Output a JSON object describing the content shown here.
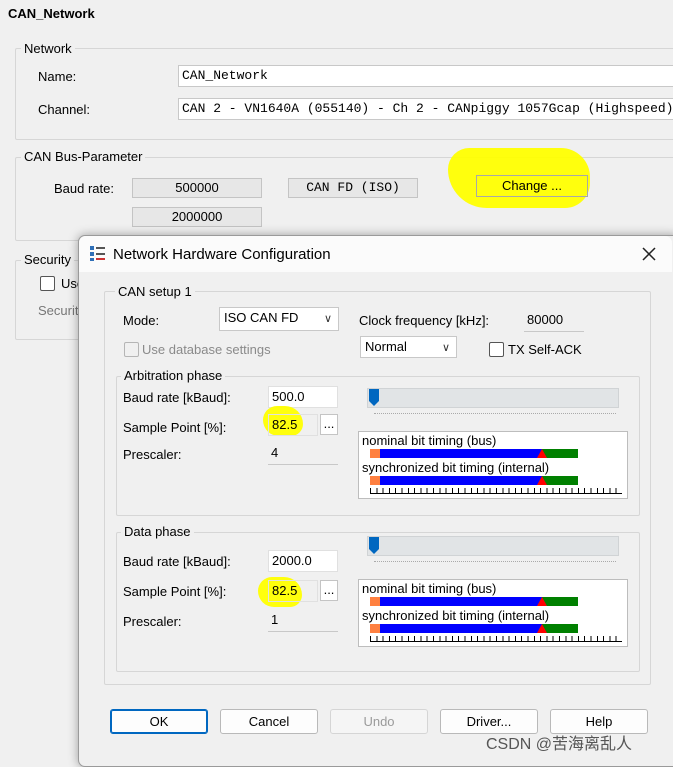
{
  "main": {
    "title": "CAN_Network",
    "network_group": "Network",
    "name_label": "Name:",
    "name_value": "CAN_Network",
    "channel_label": "Channel:",
    "channel_value": "CAN 2 - VN1640A (055140) - Ch 2 - CANpiggy 1057Gcap (Highspeed)",
    "bus_group": "CAN Bus-Parameter",
    "baud_label": "Baud rate:",
    "baud_value": "500000",
    "data_baud_value": "2000000",
    "canfd_button": "CAN FD (ISO)",
    "change_button": "Change ...",
    "security_group": "Security",
    "security_check_label": "Use",
    "security_sub": "Security"
  },
  "dialog": {
    "title": "Network Hardware Configuration",
    "setup_group": "CAN setup 1",
    "mode_label": "Mode:",
    "mode_value": "ISO CAN FD",
    "clock_label": "Clock frequency [kHz]:",
    "clock_value": "80000",
    "normal_value": "Normal",
    "use_db_label": "Use database settings",
    "tx_self_ack_label": "TX Self-ACK",
    "arb": {
      "group": "Arbitration phase",
      "baud_label": "Baud rate [kBaud]:",
      "baud_value": "500.0",
      "sp_label": "Sample Point [%]:",
      "sp_value": "82.5",
      "prescaler_label": "Prescaler:",
      "prescaler_value": "4",
      "nominal_label": "nominal bit timing (bus)",
      "sync_label": "synchronized bit timing (internal)",
      "slider_level": 0
    },
    "data": {
      "group": "Data phase",
      "baud_label": "Baud rate [kBaud]:",
      "baud_value": "2000.0",
      "sp_label": "Sample Point [%]:",
      "sp_value": "82.5",
      "prescaler_label": "Prescaler:",
      "prescaler_value": "1",
      "nominal_label": "nominal bit timing (bus)",
      "sync_label": "synchronized bit timing (internal)",
      "slider_level": 0
    },
    "ellipsis": "...",
    "buttons": {
      "ok": "OK",
      "cancel": "Cancel",
      "undo": "Undo",
      "driver": "Driver...",
      "help": "Help"
    }
  },
  "watermark": "CSDN @苦海离乱人",
  "colors": {
    "highlight": "#ffff00",
    "sync_seg": "#ff8040",
    "tseg1": "#0000ff",
    "tseg2": "#008000",
    "sample_marker": "#ff0000",
    "ok_border": "#0067c0"
  }
}
